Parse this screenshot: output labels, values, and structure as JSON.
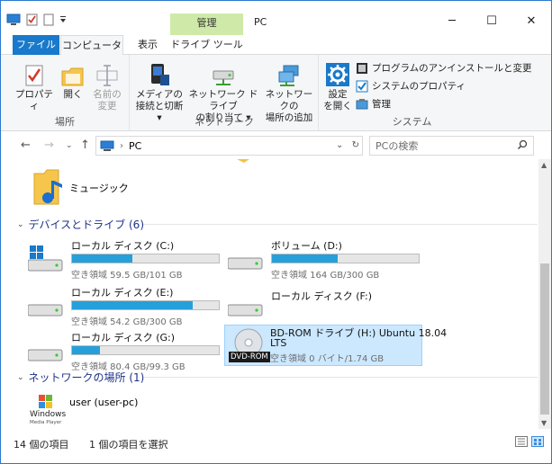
{
  "window": {
    "title": "PC",
    "context_tab_group": "管理"
  },
  "ribbon_tabs": {
    "file": "ファイル",
    "computer": "コンピューター",
    "view": "表示",
    "drive_tools": "ドライブ ツール"
  },
  "ribbon": {
    "location": {
      "label": "場所",
      "properties": "プロパティ",
      "open": "開く",
      "rename_line1": "名前の",
      "rename_line2": "変更"
    },
    "network": {
      "label": "ネットワーク",
      "media_line1": "メディアの",
      "media_line2": "接続と切断",
      "map_line1": "ネットワーク ドライブ",
      "map_line2": "の割り当て",
      "add_line1": "ネットワークの",
      "add_line2": "場所の追加"
    },
    "system": {
      "label": "システム",
      "settings_line1": "設定",
      "settings_line2": "を開く",
      "uninstall": "プログラムのアンインストールと変更",
      "sys_props": "システムのプロパティ",
      "manage": "管理"
    }
  },
  "address": {
    "path": "PC",
    "search_placeholder": "PCの検索"
  },
  "folders": {
    "music": "ミュージック"
  },
  "sections": {
    "devices": "デバイスとドライブ (6)",
    "network": "ネットワークの場所 (1)"
  },
  "drives": [
    {
      "name": "ローカル ディスク (C:)",
      "free": "空き領域 59.5 GB/101 GB",
      "used_fraction": 0.41
    },
    {
      "name": "ボリューム (D:)",
      "free": "空き領域 164 GB/300 GB",
      "used_fraction": 0.45
    },
    {
      "name": "ローカル ディスク (E:)",
      "free": "空き領域 54.2 GB/300 GB",
      "used_fraction": 0.82
    },
    {
      "name": "ローカル ディスク (F:)"
    },
    {
      "name": "ローカル ディスク (G:)",
      "free": "空き領域 80.4 GB/99.3 GB",
      "used_fraction": 0.19
    },
    {
      "name_line1": "BD-ROM ドライブ (H:) Ubuntu 18.04",
      "name_line2": "LTS",
      "free": "空き領域 0 バイト/1.74 GB",
      "badge": "DVD-ROM"
    }
  ],
  "network_location": {
    "name": "user (user-pc)",
    "logo_text": "Windows",
    "logo_sub": "Media Player"
  },
  "status": {
    "items": "14 個の項目",
    "selected": "1 個の項目を選択"
  },
  "colors": {
    "accent": "#1979ca",
    "bar_fill": "#26a0da",
    "selection": "#cce8ff",
    "context_tab": "#cfeaa8"
  }
}
